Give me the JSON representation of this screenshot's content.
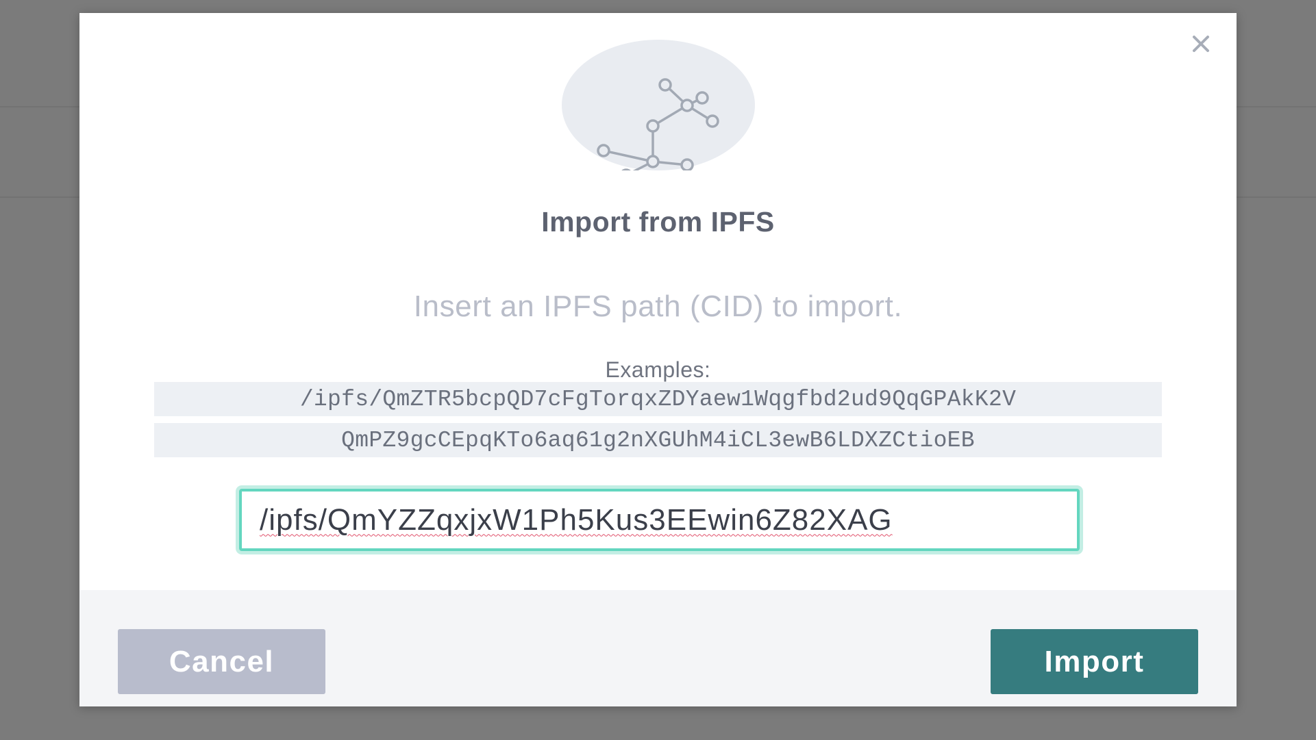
{
  "modal": {
    "title": "Import from IPFS",
    "subtitle": "Insert an IPFS path (CID) to import.",
    "examples_label": "Examples:",
    "examples": [
      "/ipfs/QmZTR5bcpQD7cFgTorqxZDYaew1Wqgfbd2ud9QqGPAkK2V",
      "QmPZ9gcCEpqKTo6aq61g2nXGUhM4iCL3ewB6LDXZCtioEB"
    ],
    "input": {
      "value": "/ipfs/QmYZZqxjxW1Ph5Kus3EEwin6Z82XAG"
    },
    "buttons": {
      "cancel": "Cancel",
      "import": "Import"
    },
    "icons": {
      "close": "close-icon",
      "hero": "ipfs-graph-icon"
    }
  },
  "colors": {
    "accent_focus": "#63d6bf",
    "import_button": "#367c7f",
    "cancel_button": "#b8bccc",
    "overlay": "#7b7b7b"
  }
}
